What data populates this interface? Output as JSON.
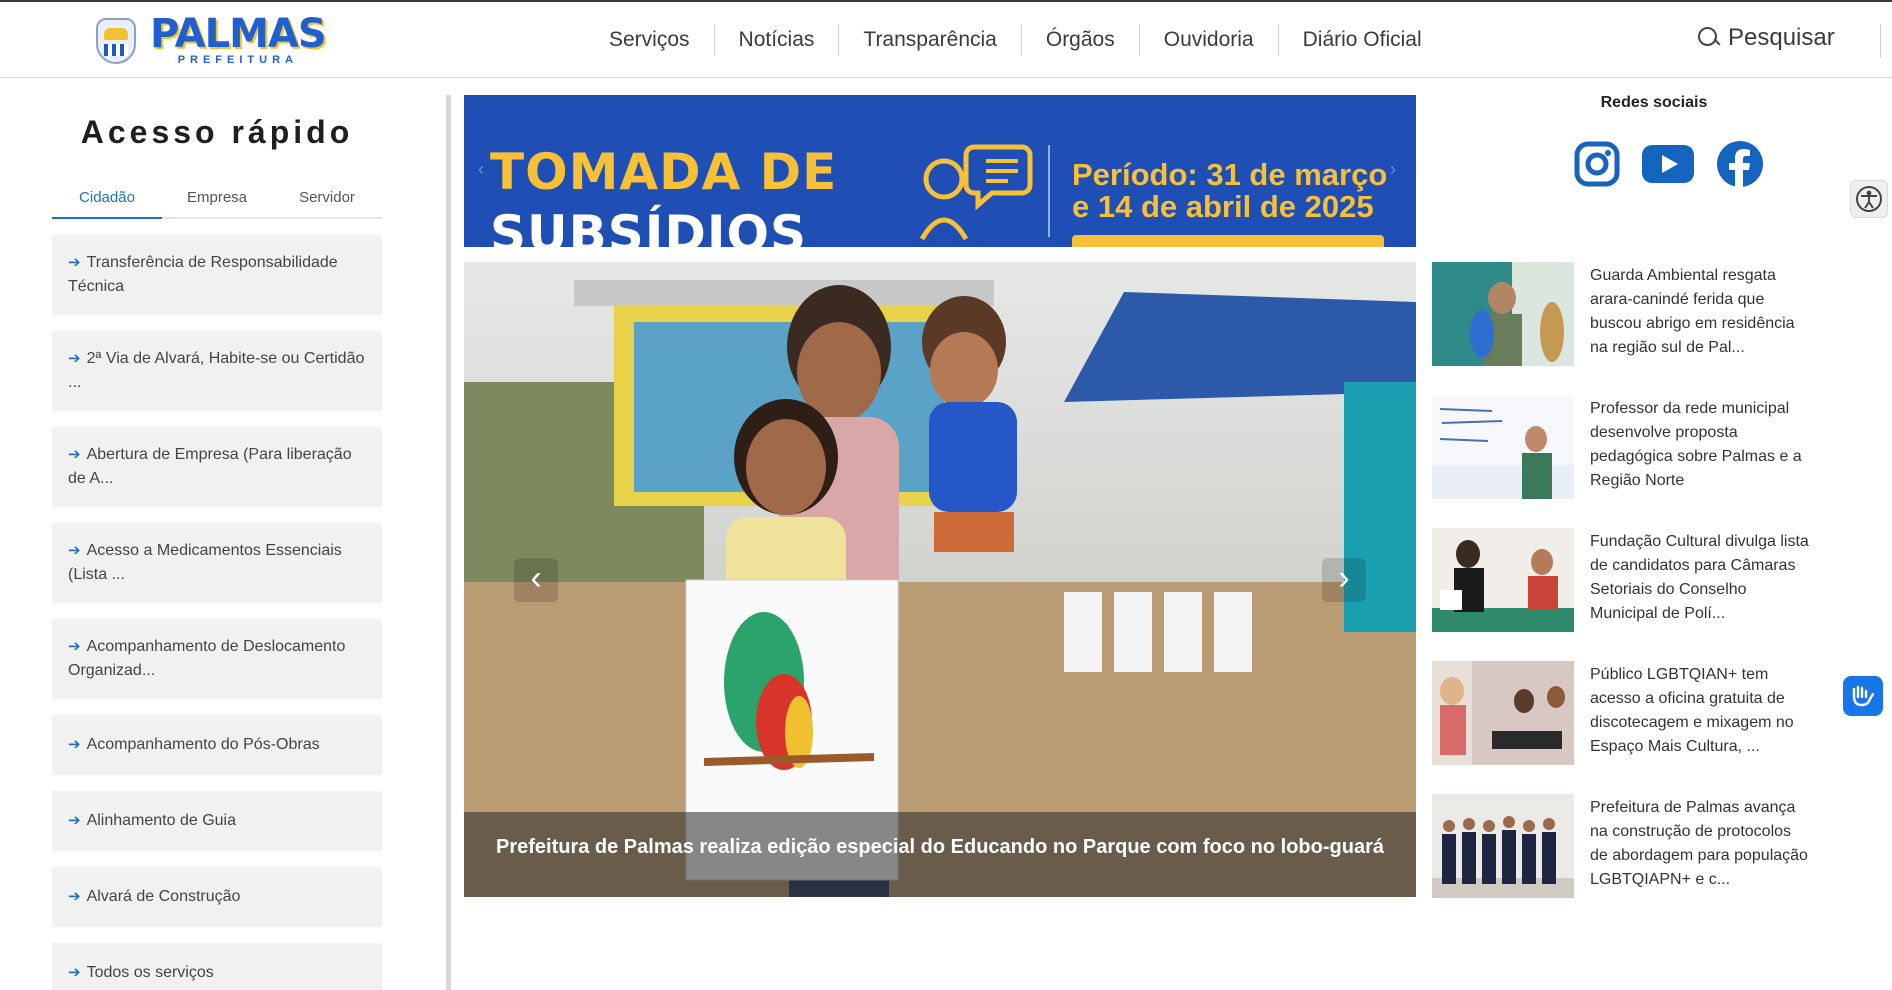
{
  "header": {
    "logo_word": "PALMAS",
    "logo_sub": "PREFEITURA",
    "nav": [
      "Serviços",
      "Notícias",
      "Transparência",
      "Órgãos",
      "Ouvidoria",
      "Diário Oficial"
    ],
    "search_label": "Pesquisar"
  },
  "sidebar": {
    "title": "Acesso rápido",
    "tabs": [
      "Cidadão",
      "Empresa",
      "Servidor"
    ],
    "active_tab": "Cidadão",
    "items": [
      "Transferência de Responsabilidade Técnica",
      "2ª Via de Alvará, Habite-se ou Certidão ...",
      "Abertura de Empresa (Para liberação de A...",
      "Acesso a Medicamentos Essenciais (Lista ...",
      "Acompanhamento de Deslocamento Organizad...",
      "Acompanhamento do Pós-Obras",
      "Alinhamento de Guia",
      "Alvará de Construção",
      "Todos os serviços"
    ]
  },
  "banner": {
    "line1": "TOMADA DE",
    "line2": "SUBSÍDIOS",
    "period_line1": "Período: 31 de março",
    "period_line2": "e 14 de abril de 2025",
    "color_bg": "#1f4fb5",
    "color_accent": "#f7c037"
  },
  "hero": {
    "caption": "Prefeitura de Palmas realiza edição especial do Educando no Parque com foco no lobo-guará"
  },
  "social": {
    "title": "Redes sociais",
    "icons": [
      "instagram-icon",
      "youtube-icon",
      "facebook-icon"
    ]
  },
  "news": [
    "Guarda Ambiental resgata arara-canindé ferida que buscou abrigo em residência na região sul de Pal...",
    "Professor da rede municipal desenvolve proposta pedagógica sobre Palmas e a Região Norte",
    "Fundação Cultural divulga lista de candidatos para Câmaras Setoriais do Conselho Municipal de Polí...",
    "Público LGBTQIAN+ tem acesso a oficina gratuita de discotecagem e mixagem no Espaço Mais Cultura, ...",
    "Prefeitura de Palmas avança na construção de protocolos de abordagem para população LGBTQIAPN+ e c..."
  ],
  "accent_color": "#1a73c9"
}
